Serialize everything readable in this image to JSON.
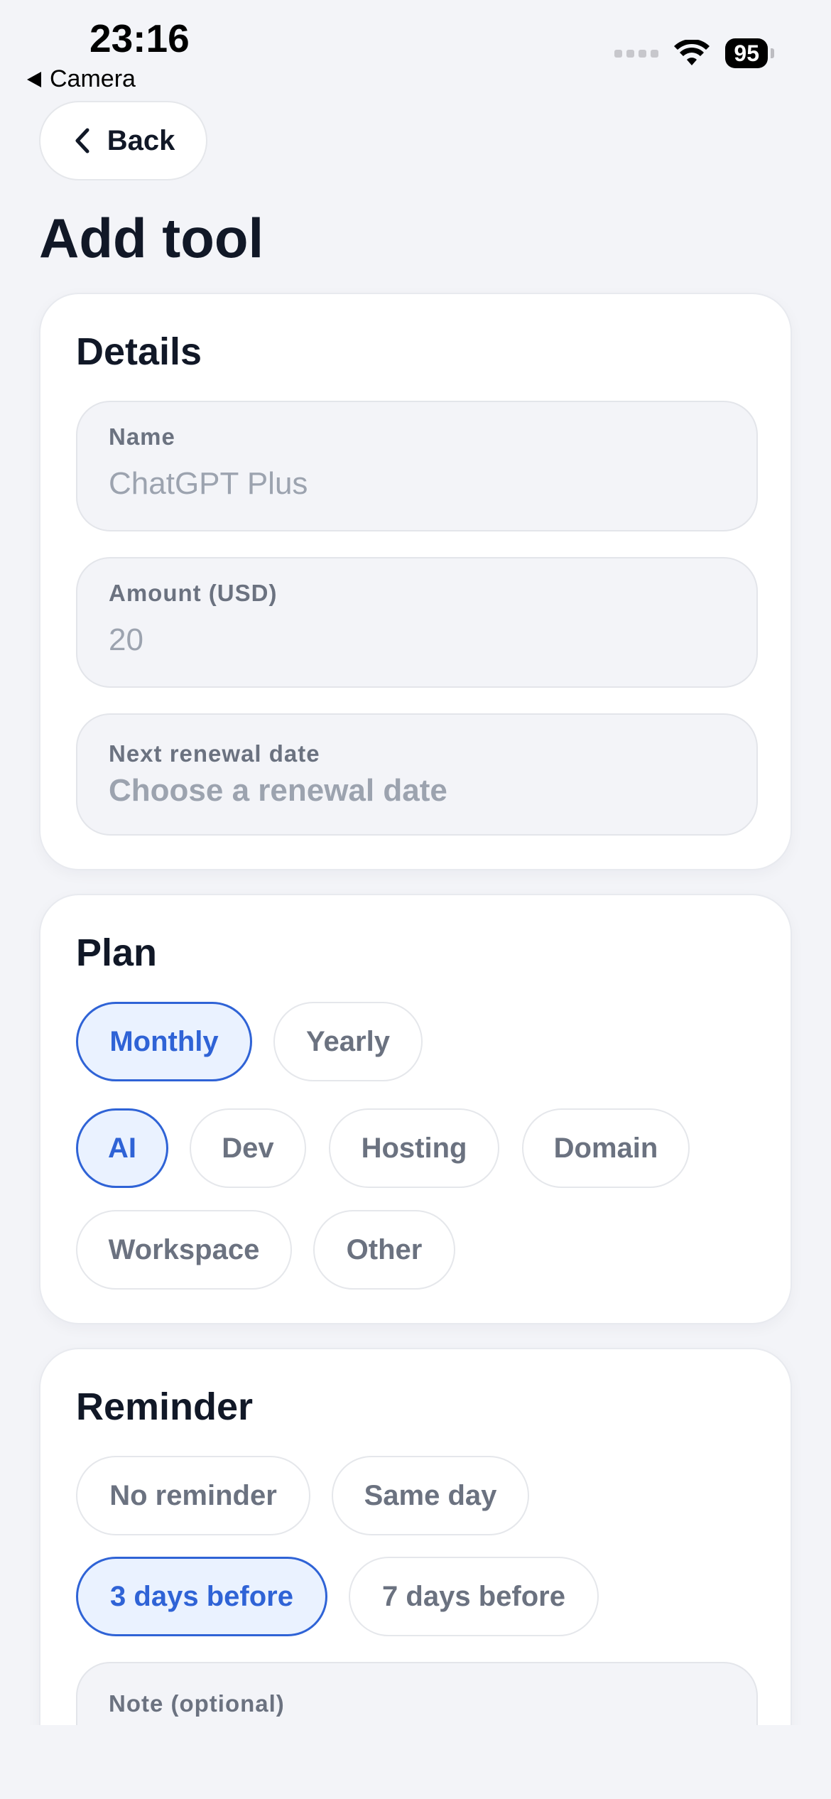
{
  "status_bar": {
    "time": "23:16",
    "back_app": "Camera",
    "battery": "95"
  },
  "nav": {
    "back_label": "Back"
  },
  "page_title": "Add tool",
  "details": {
    "title": "Details",
    "name": {
      "label": "Name",
      "placeholder": "ChatGPT Plus"
    },
    "amount": {
      "label": "Amount (USD)",
      "placeholder": "20"
    },
    "renewal": {
      "label": "Next renewal date",
      "placeholder": "Choose a renewal date"
    }
  },
  "plan": {
    "title": "Plan",
    "billing": [
      {
        "label": "Monthly",
        "selected": true
      },
      {
        "label": "Yearly",
        "selected": false
      }
    ],
    "categories": [
      {
        "label": "AI",
        "selected": true
      },
      {
        "label": "Dev",
        "selected": false
      },
      {
        "label": "Hosting",
        "selected": false
      },
      {
        "label": "Domain",
        "selected": false
      },
      {
        "label": "Workspace",
        "selected": false
      },
      {
        "label": "Other",
        "selected": false
      }
    ]
  },
  "reminder": {
    "title": "Reminder",
    "options": [
      {
        "label": "No reminder",
        "selected": false
      },
      {
        "label": "Same day",
        "selected": false
      },
      {
        "label": "3 days before",
        "selected": true
      },
      {
        "label": "7 days before",
        "selected": false
      }
    ],
    "note": {
      "label": "Note (optional)"
    }
  },
  "colors": {
    "accent": "#2f63d6",
    "accent_bg": "#eaf2ff",
    "background": "#f3f4f8"
  }
}
